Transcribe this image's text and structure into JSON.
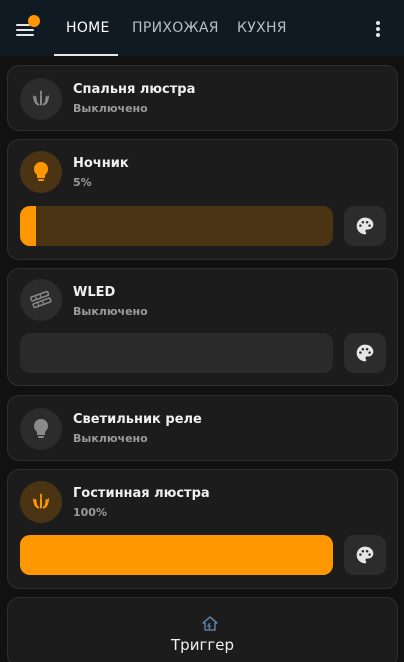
{
  "header": {
    "tabs": [
      {
        "label": "HOME",
        "active": true
      },
      {
        "label": "ПРИХОЖАЯ",
        "active": false
      },
      {
        "label": "КУХНЯ",
        "active": false
      }
    ],
    "notification_dot_color": "#ff9800"
  },
  "cards": [
    {
      "name": "Спальня люстра",
      "state": "Выключено",
      "icon": "chandelier-icon",
      "on": false
    },
    {
      "name": "Ночник",
      "state": "5%",
      "icon": "lightbulb-icon",
      "on": true,
      "brightness_percent": 5,
      "has_slider": true
    },
    {
      "name": "WLED",
      "state": "Выключено",
      "icon": "led-strip-icon",
      "on": false,
      "brightness_percent": 0,
      "has_slider": true
    },
    {
      "name": "Светильник реле",
      "state": "Выключено",
      "icon": "lightbulb-icon",
      "on": false
    },
    {
      "name": "Гостинная люстра",
      "state": "100%",
      "icon": "chandelier-icon",
      "on": true,
      "brightness_percent": 100,
      "has_slider": true
    }
  ],
  "trigger": {
    "label": "Триггер",
    "icon": "home-automation-icon"
  },
  "colors": {
    "accent": "#ff9800",
    "slider_track_on": "#4a3414",
    "slider_track_off": "#2a2a2a",
    "card_background": "#1c1c1c",
    "header_background": "#101a23"
  }
}
